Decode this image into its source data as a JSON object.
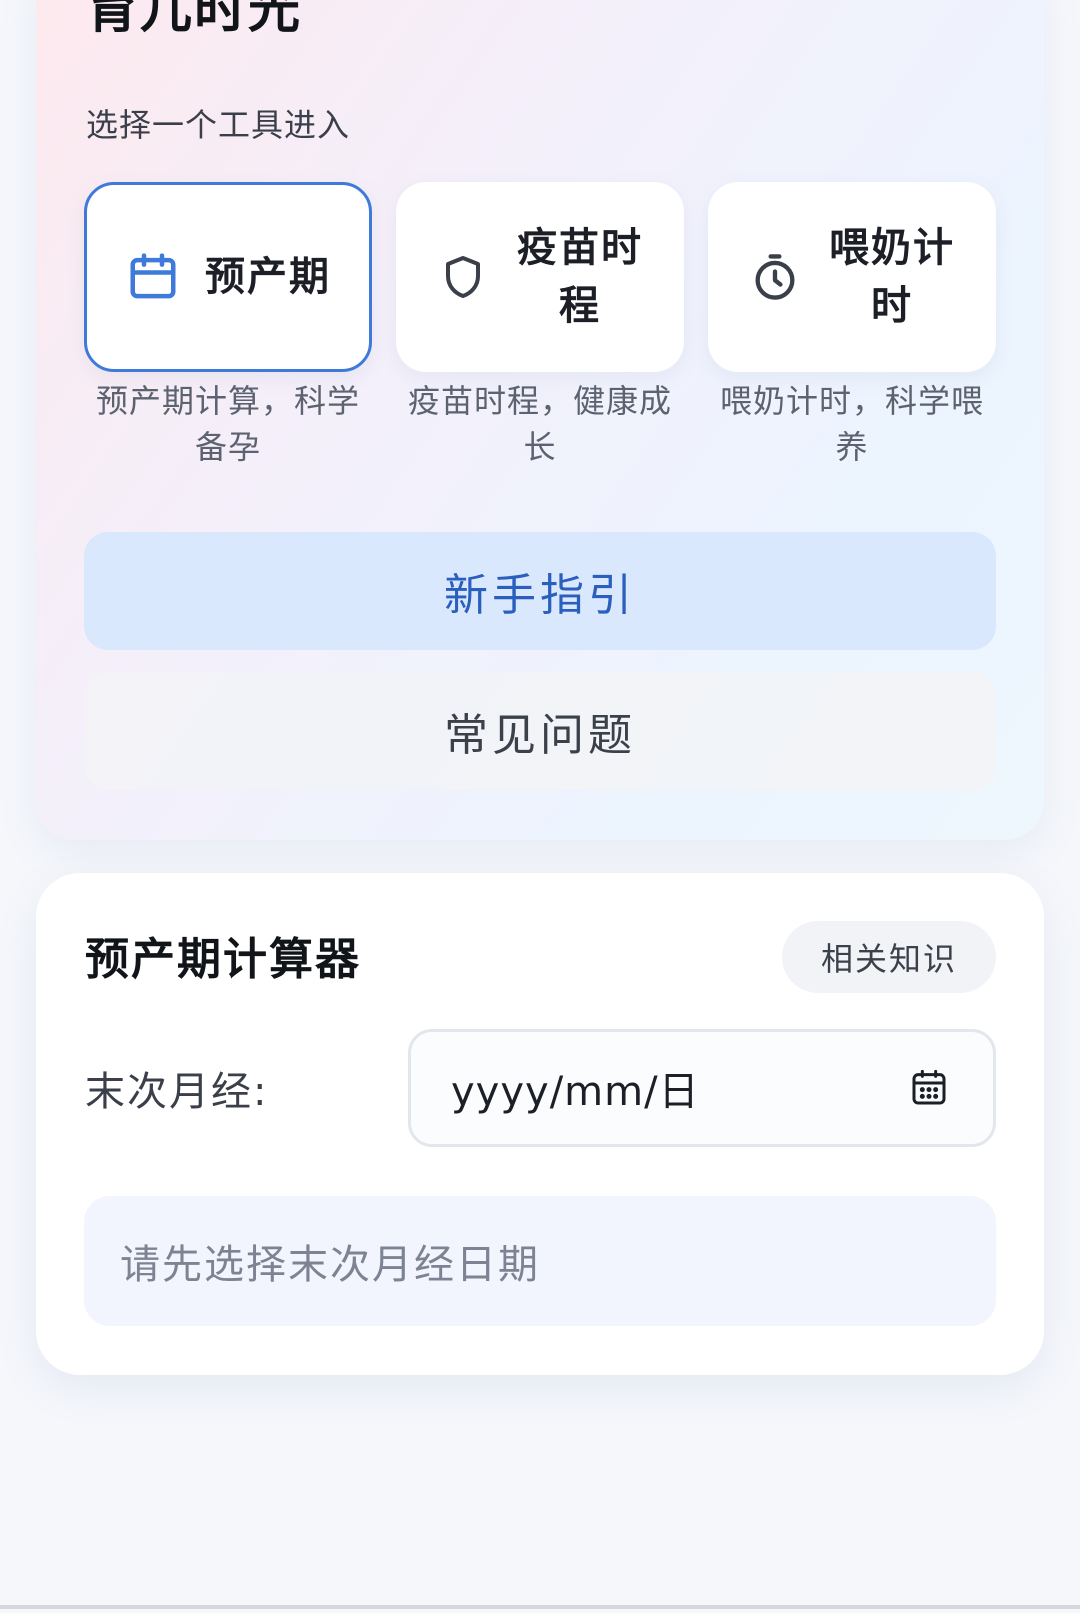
{
  "app": {
    "title": "育儿时光",
    "subtitle": "选择一个工具进入"
  },
  "tools": [
    {
      "name": "预产期",
      "description": "预产期计算，科学备孕",
      "icon": "calendar-icon",
      "active": true
    },
    {
      "name": "疫苗时程",
      "description": "疫苗时程，健康成长",
      "icon": "shield-icon",
      "active": false
    },
    {
      "name": "喂奶计时",
      "description": "喂奶计时，科学喂养",
      "icon": "stopwatch-icon",
      "active": false
    }
  ],
  "buttons": {
    "guide": "新手指引",
    "faq": "常见问题"
  },
  "calculator": {
    "title": "预产期计算器",
    "related_chip": "相关知识",
    "last_period_label": "末次月经:",
    "date_placeholder": "yyyy/mm/日",
    "result_text": "请先选择末次月经日期"
  },
  "colors": {
    "accent": "#3d7ad9",
    "guide_bg": "#d9e8fd",
    "guide_text": "#2a5fbd",
    "result_bg": "#f2f5fe"
  }
}
